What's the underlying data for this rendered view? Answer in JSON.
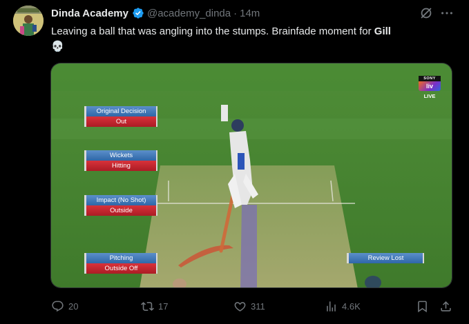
{
  "tweet": {
    "author": {
      "display_name": "Dinda Academy",
      "handle": "@academy_dinda",
      "verified_icon": "verified-badge-icon",
      "avatar": "avatar"
    },
    "separator": "·",
    "time": "14m",
    "text_before": "Leaving a ball that was angling into the stumps. Brainfade moment for ",
    "mention": "Gill",
    "emoji": "💀",
    "icons": {
      "grok": "grok-icon",
      "more": "more-icon"
    }
  },
  "media": {
    "broadcaster": {
      "brand": "SONY",
      "sub": "liv",
      "live": "LIVE"
    },
    "drs": [
      {
        "title": "Original Decision",
        "value": "Out"
      },
      {
        "title": "Wickets",
        "value": "Hitting"
      },
      {
        "title": "Impact (No Shot)",
        "value": "Outside"
      },
      {
        "title": "Pitching",
        "value": "Outside Off"
      }
    ],
    "review_status": "Review Lost",
    "colors": {
      "panel_blue": "#3a76b8",
      "panel_red": "#c42a31",
      "pitch_green": "#4b8a34"
    }
  },
  "actions": {
    "replies": "20",
    "reposts": "17",
    "likes": "311",
    "views": "4.6K",
    "icons": [
      "reply-icon",
      "repost-icon",
      "like-icon",
      "views-icon",
      "bookmark-icon",
      "share-icon"
    ]
  }
}
